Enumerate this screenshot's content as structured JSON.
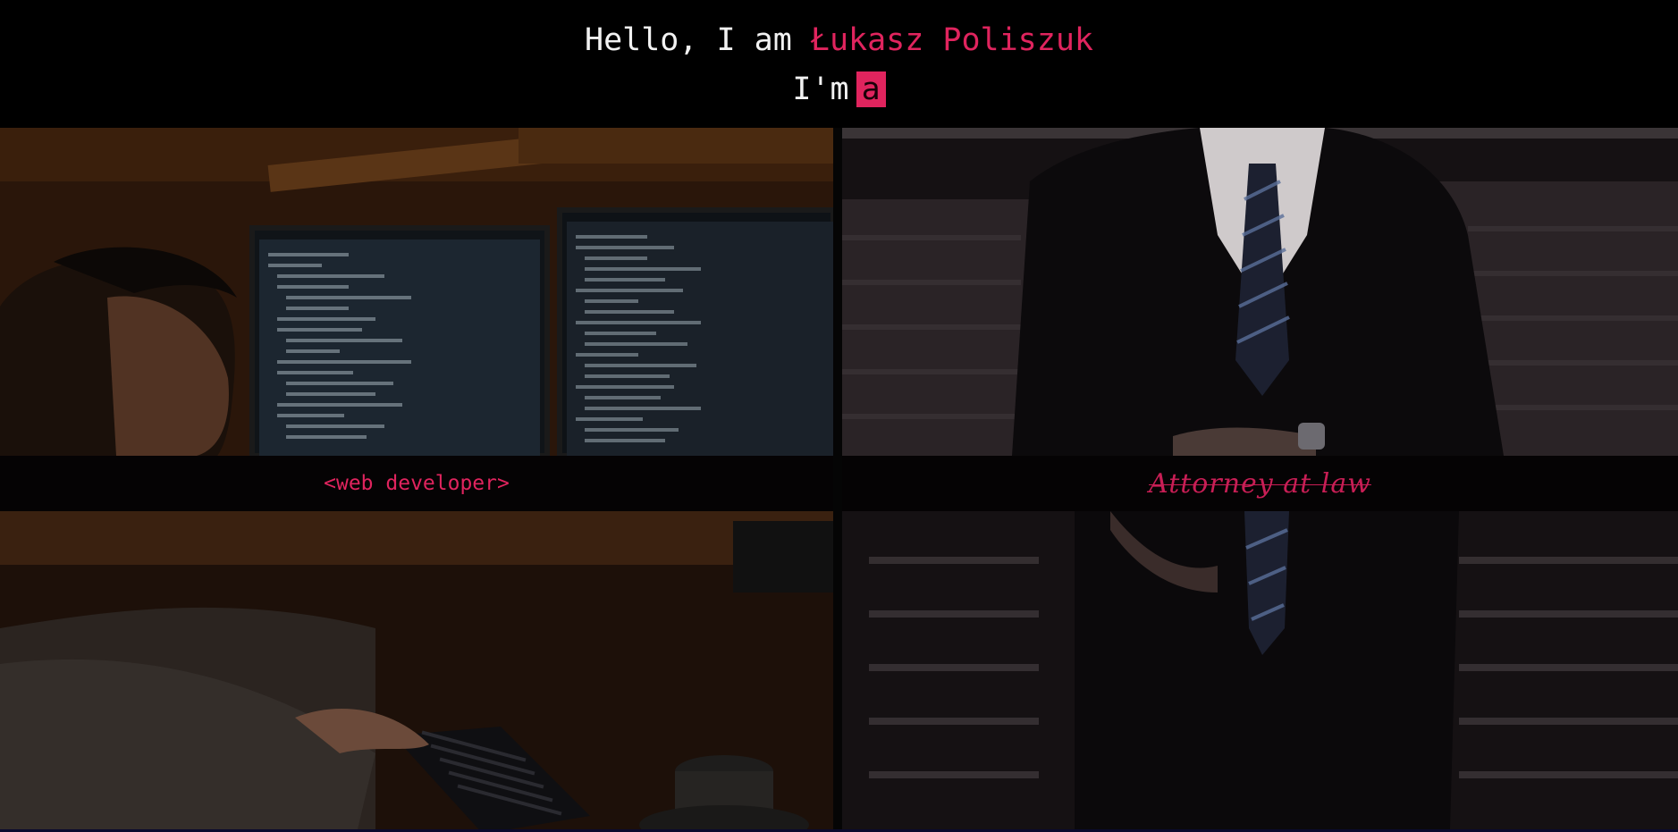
{
  "header": {
    "greeting_prefix": "Hello, I am ",
    "name": "Łukasz Poliszuk",
    "role_prefix": "I'm",
    "typed_text": "a"
  },
  "panels": {
    "developer": {
      "label": "<web developer>"
    },
    "attorney": {
      "label": "Attorney at law"
    }
  },
  "colors": {
    "accent": "#e0245e",
    "background": "#000000",
    "text": "#f2f2f2"
  }
}
